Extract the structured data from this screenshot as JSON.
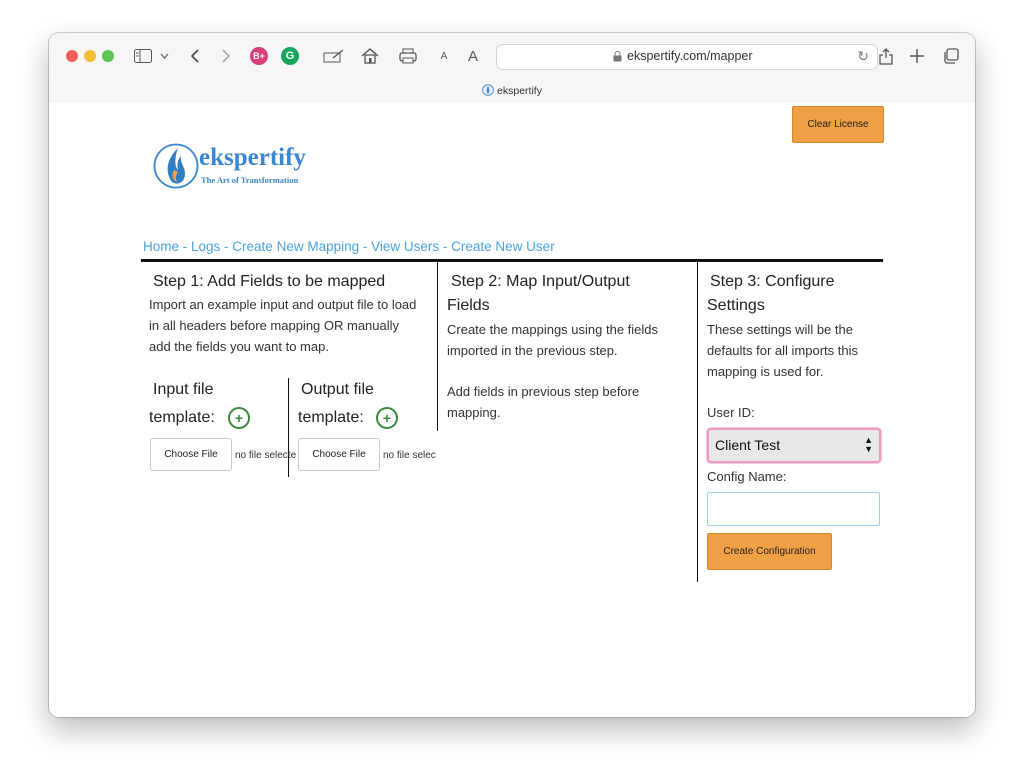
{
  "browser": {
    "url": "ekspertify.com/mapper",
    "tab_title": "ekspertify",
    "font_small": "A",
    "font_large": "A",
    "extension_1": "B+",
    "extension_2": "G"
  },
  "header": {
    "clear_license_label": "Clear License",
    "logo_name": "ekspertify",
    "logo_tagline": "The Art of Transformation"
  },
  "nav": {
    "items": [
      "Home",
      "Logs",
      "Create New Mapping",
      "View Users",
      "Create New User"
    ],
    "separator": " - "
  },
  "step1": {
    "title": "Step 1: Add Fields to be mapped",
    "description": "Import an example input and output file to load in all headers before mapping OR manually add the fields you want to map.",
    "input_label_line1": "Input file",
    "input_label_line2": "template:",
    "output_label_line1": "Output file",
    "output_label_line2": "template:",
    "choose_file_label": "Choose File",
    "no_file_input": "no file selecte",
    "no_file_output": "no file selec",
    "plus": "+"
  },
  "step2": {
    "title_line1": "Step 2: Map Input/Output",
    "title_line2": "Fields",
    "description": "Create the mappings using the fields imported in the previous step.",
    "note": "Add fields in previous step before mapping."
  },
  "step3": {
    "title_line1": "Step 3: Configure",
    "title_line2": "Settings",
    "description": "These settings will be the defaults for all imports this mapping is used for.",
    "user_id_label": "User ID:",
    "user_id_value": "Client Test",
    "config_name_label": "Config Name:",
    "config_name_value": "",
    "create_button_label": "Create Configuration"
  },
  "colors": {
    "accent_orange": "#f0a044",
    "link_blue": "#4aa3df",
    "plus_green": "#3a8a3a",
    "select_focus": "#e99bc0"
  }
}
